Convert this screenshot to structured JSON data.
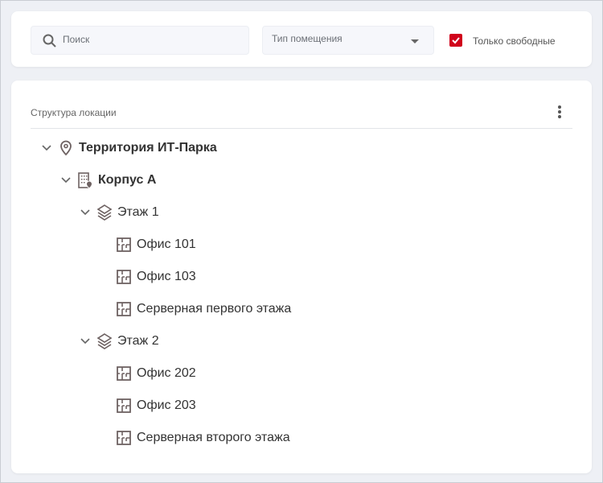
{
  "filters": {
    "search_placeholder": "Поиск",
    "room_type_placeholder": "Тип помещения",
    "only_free_label": "Только свободные",
    "only_free_checked": true
  },
  "structure": {
    "title": "Структура локации",
    "nodes": [
      {
        "label": "Территория ИТ-Парка",
        "icon": "location-pin-icon"
      },
      {
        "label": "Корпус А",
        "icon": "building-icon"
      },
      {
        "label": "Этаж 1",
        "icon": "layers-icon"
      },
      {
        "label": "Офис 101",
        "icon": "floorplan-icon"
      },
      {
        "label": "Офис 103",
        "icon": "floorplan-icon"
      },
      {
        "label": "Серверная первого этажа",
        "icon": "floorplan-icon"
      },
      {
        "label": "Этаж 2",
        "icon": "layers-icon"
      },
      {
        "label": "Офис 202",
        "icon": "floorplan-icon"
      },
      {
        "label": "Офис 203",
        "icon": "floorplan-icon"
      },
      {
        "label": "Серверная второго этажа",
        "icon": "floorplan-icon"
      }
    ]
  },
  "colors": {
    "accent": "#d0021b",
    "icon": "#6e6262"
  }
}
